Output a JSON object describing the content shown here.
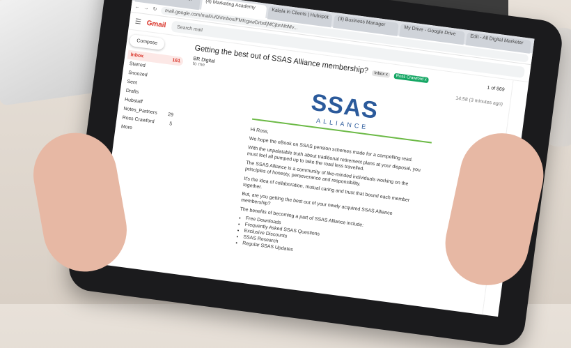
{
  "browser": {
    "tabs": [
      "(7267) SSS Checklist for",
      "(4) Marketing Academy",
      "Kalala in Clients | Hubspot",
      "(3) Business Manager",
      "My Drive - Google Drive",
      "Edit - All Digital Marketer"
    ],
    "url": "mail.google.com/mail/u/0/#inbox/FMfcgxwDrbsfjMCjbnNhMv..."
  },
  "gmail": {
    "app": "Gmail",
    "search_placeholder": "Search mail",
    "compose": "Compose",
    "nav": [
      {
        "label": "Inbox",
        "count": "161"
      },
      {
        "label": "Starred",
        "count": ""
      },
      {
        "label": "Snoozed",
        "count": ""
      },
      {
        "label": "Sent",
        "count": ""
      },
      {
        "label": "Drafts",
        "count": ""
      },
      {
        "label": "Hubstaff",
        "count": ""
      },
      {
        "label": "Notes_Partners",
        "count": "29"
      },
      {
        "label": "Ross Crawford",
        "count": "5"
      },
      {
        "label": "More",
        "count": ""
      }
    ],
    "subject": "Getting the best out of SSAS Alliance membership?",
    "labels": [
      "Inbox x",
      "Ross Crawford x"
    ],
    "pager": "1 of 869",
    "sender": "BR Digital",
    "to": "to me",
    "time": "14:58 (3 minutes ago)",
    "logo_main": "SSAS",
    "logo_sub": "ALLIANCE",
    "greeting": "Hi Ross,",
    "paragraphs": [
      "We hope the eBook on SSAS pension schemes made for a compelling read.",
      "With the unpalatable truth about traditional retirement plans at your disposal, you must feel all pumped up to take the road less travelled.",
      "The SSAS Alliance is a community of like-minded individuals working on the principles of honesty, perseverance and responsibility.",
      "It's the idea of collaboration, mutual caring and trust that bound each member together.",
      "But, are you getting the best out of your newly acquired SSAS Alliance membership?",
      "The benefits of becoming a part of SSAS Alliance include:"
    ],
    "benefits": [
      "Free Downloads",
      "Frequently Asked SSAS Questions",
      "Exclusive Discounts",
      "SSAS Research",
      "Regular SSAS Updates"
    ]
  }
}
